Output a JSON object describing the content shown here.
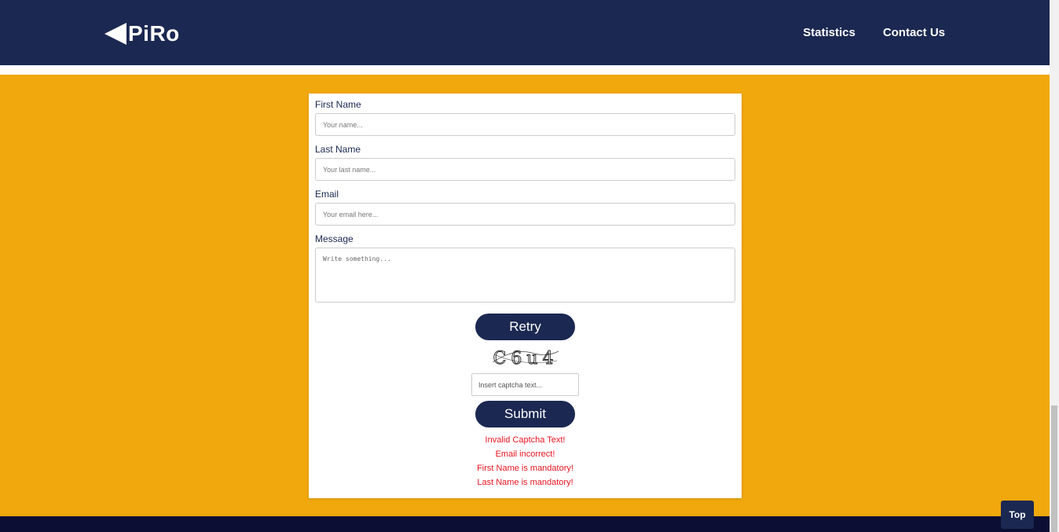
{
  "nav": {
    "logo_text": "PiRo",
    "links": [
      "Statistics",
      "Contact Us"
    ]
  },
  "form": {
    "first_name": {
      "label": "First Name",
      "placeholder": "Your name..."
    },
    "last_name": {
      "label": "Last Name",
      "placeholder": "Your last name..."
    },
    "email": {
      "label": "Email",
      "placeholder": "Your email here..."
    },
    "message": {
      "label": "Message",
      "placeholder": "Write something..."
    },
    "retry_label": "Retry",
    "captcha_text": "C6u4",
    "captcha_placeholder": "Insert captcha text...",
    "submit_label": "Submit",
    "errors": [
      "Invalid Captcha Text!",
      "Email incorrect!",
      "First Name is mandatory!",
      "Last Name is mandatory!"
    ]
  },
  "top_button": "Top",
  "colors": {
    "navy": "#1b2851",
    "background": "#f0a80d",
    "error": "#e8141f",
    "footer": "#0c0f33"
  }
}
